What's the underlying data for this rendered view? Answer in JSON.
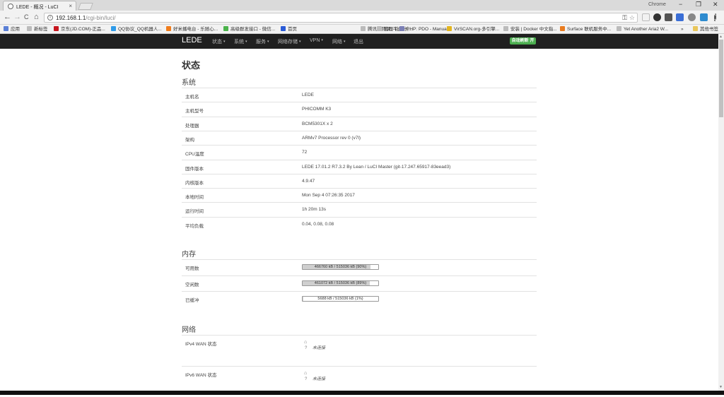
{
  "browser": {
    "tab_title": "LEDE - 概况 - LuCI",
    "tab_close": "×",
    "profile_label": "Chrome",
    "window_buttons": {
      "minimize": "−",
      "restore": "❐",
      "close": "✕"
    },
    "url_host": "192.168.1.1",
    "url_path": "/cgi-bin/luci/",
    "info_glyph": "i",
    "key_glyph": "⚿",
    "star_glyph": "☆",
    "nav": {
      "back": "←",
      "forward": "→",
      "reload": "C",
      "home": "⌂"
    }
  },
  "bookmarks": [
    {
      "label": "应用",
      "color": "#5a7fd6"
    },
    {
      "label": "新标签",
      "color": "#bbbbbb"
    },
    {
      "label": "京东(JD.COM)-正品...",
      "color": "#c7161e"
    },
    {
      "label": "QQ协议_QQ机器人...",
      "color": "#2f9be9"
    },
    {
      "label": "好米播电台 - 乐随心...",
      "color": "#f07c1b"
    },
    {
      "label": "高级群发接口 - 微信...",
      "color": "#4bb34b"
    },
    {
      "label": "首页",
      "color": "#2a5bd7"
    },
    {
      "label": "腾讯视频课 - 让成长...",
      "color": "#bbbbbb"
    },
    {
      "label": "管理平台",
      "color": "#bbbbbb"
    },
    {
      "label": "PHP: PDO - Manual",
      "color": "#7b7fb5"
    },
    {
      "label": "VirSCAN.org-多引擎...",
      "color": "#e3b51e"
    },
    {
      "label": "安装 | Docker 中文指...",
      "color": "#bbbbbb"
    },
    {
      "label": "Surface 联机服务中...",
      "color": "#e97b1e"
    },
    {
      "label": "Yet Another Aria2 W...",
      "color": "#bbbbbb"
    },
    {
      "label": "»",
      "color": ""
    },
    {
      "label": "其他书签",
      "color": "#e9c65a"
    }
  ],
  "navbar": {
    "brand": "LEDE",
    "menu": [
      "状态",
      "系统",
      "服务",
      "网络存储",
      "VPN",
      "网络",
      "退出"
    ],
    "caret": "▾",
    "refresh_label": "自动刷新 开"
  },
  "page": {
    "title": "状态",
    "system": {
      "heading": "系统",
      "rows": [
        {
          "label": "主机名",
          "value": "LEDE"
        },
        {
          "label": "主机型号",
          "value": "PHICOMM K3"
        },
        {
          "label": "处理器",
          "value": "BCM5301X x 2"
        },
        {
          "label": "架构",
          "value": "ARMv7 Processor rev 0 (v7l)"
        },
        {
          "label": "CPU温度",
          "value": "72"
        },
        {
          "label": "固件版本",
          "value": "LEDE 17.01.2 R7.3.2 By Lean / LuCI Master (git-17.247.65917-83eead3)"
        },
        {
          "label": "内核版本",
          "value": "4.9.47"
        },
        {
          "label": "本地时间",
          "value": "Mon Sep 4 07:26:35 2017"
        },
        {
          "label": "运行时间",
          "value": "1h 20m 13s"
        },
        {
          "label": "平均负载",
          "value": "0.04, 0.08, 0.08"
        }
      ]
    },
    "memory": {
      "heading": "内存",
      "rows": [
        {
          "label": "可用数",
          "text": "466760 kB / 515036 kB (90%)",
          "fraction": 0.9
        },
        {
          "label": "空闲数",
          "text": "461072 kB / 515036 kB (89%)",
          "fraction": 0.89
        },
        {
          "label": "已缓冲",
          "text": "5688 kB / 515036 kB (1%)",
          "fraction": 0.01
        }
      ]
    },
    "network": {
      "heading": "网络",
      "rows": [
        {
          "label": "IPv4 WAN 状态",
          "icon_glyph": "⌂",
          "question": "?",
          "status": "未连接"
        },
        {
          "label": "IPv6 WAN 状态",
          "icon_glyph": "⌂",
          "question": "?",
          "status": "未连接"
        }
      ]
    }
  },
  "scrollbar": {
    "up": "▲",
    "down": "▼"
  }
}
